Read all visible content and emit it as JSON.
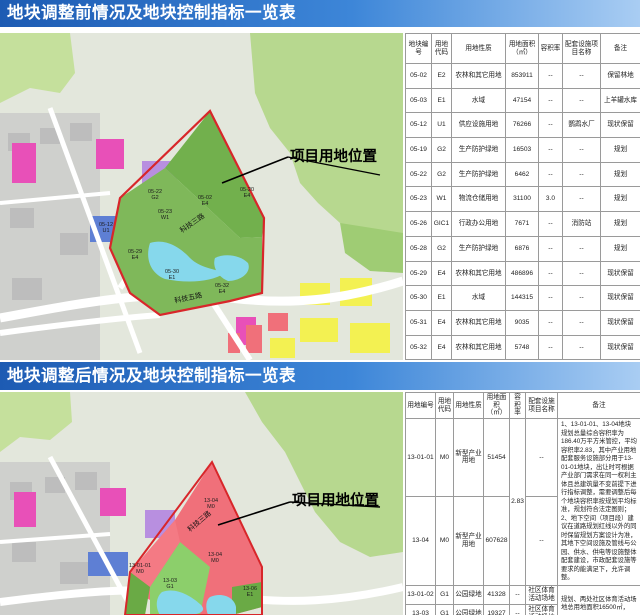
{
  "top_section": {
    "title": "地块调整前情况及地块控制指标一览表",
    "callout": "项目用地位置",
    "map_labels": {
      "road_1": "科技三路",
      "road_2": "科技五路",
      "road_3": "白沙洲大道",
      "road_4": "科技二路",
      "road_5": "四环线大道",
      "parcels": [
        "05-22\nG2",
        "05-23\nW1",
        "05-28\nG2",
        "05-29\nE4",
        "05-30\nE1",
        "05-32\nE4",
        "05-12\nU1",
        "05-02\nE4",
        "05-20\nE4"
      ]
    },
    "table": {
      "headers": [
        "地块编号",
        "用地代码",
        "用地性质",
        "用地面积（㎡）",
        "容积率",
        "配套设施项目名称",
        "备注"
      ],
      "rows": [
        [
          "05-02",
          "E2",
          "农林和其它用地",
          "853911",
          "--",
          "--",
          "保留林地"
        ],
        [
          "05-03",
          "E1",
          "水域",
          "47154",
          "--",
          "--",
          "上羊罐水库"
        ],
        [
          "05-12",
          "U1",
          "供应设施用地",
          "76266",
          "--",
          "鹦鹉水厂",
          "现状保留"
        ],
        [
          "05-19",
          "G2",
          "生产防护绿地",
          "16503",
          "--",
          "--",
          "规划"
        ],
        [
          "05-22",
          "G2",
          "生产防护绿地",
          "6462",
          "--",
          "--",
          "规划"
        ],
        [
          "05-23",
          "W1",
          "物流仓储用地",
          "31100",
          "3.0",
          "--",
          "规划"
        ],
        [
          "05-26",
          "GIC1",
          "行政办公用地",
          "7671",
          "--",
          "消防站",
          "规划"
        ],
        [
          "05-28",
          "G2",
          "生产防护绿地",
          "6876",
          "--",
          "--",
          "规划"
        ],
        [
          "05-29",
          "E4",
          "农林和其它用地",
          "486896",
          "--",
          "--",
          "现状保留"
        ],
        [
          "05-30",
          "E1",
          "水域",
          "144315",
          "--",
          "--",
          "现状保留"
        ],
        [
          "05-31",
          "E4",
          "农林和其它用地",
          "9035",
          "--",
          "--",
          "现状保留"
        ],
        [
          "05-32",
          "E4",
          "农林和其它用地",
          "5748",
          "--",
          "--",
          "现状保留"
        ]
      ]
    }
  },
  "bottom_section": {
    "title": "地块调整后情况及地块控制指标一览表",
    "callout": "项目用地位置",
    "map_labels": {
      "road_1": "科技三路",
      "road_2": "科技五路",
      "parcel_a": "13-04\nM0",
      "parcel_b": "13-01-01\nM0",
      "parcel_c": "13-06\nE1",
      "parcel_d": "13-03\nG1",
      "parcel_e": "13-01-02\nG1",
      "parcel_f": "13-07\nE4"
    },
    "table": {
      "headers": [
        "用地编号",
        "用地代码",
        "用地性质",
        "用地面积（㎡）",
        "容积率",
        "配套设施项目名称",
        "备注"
      ],
      "rows": [
        [
          "13-01-01",
          "M0",
          "新型产业用地",
          "51454",
          "2.83",
          "--"
        ],
        [
          "13-04",
          "M0",
          "新型产业用地",
          "607628",
          "",
          "--"
        ],
        [
          "13-01-02",
          "G1",
          "公园绿地",
          "41328",
          "--",
          "社区体育活动场地"
        ],
        [
          "13-03",
          "G1",
          "公园绿地",
          "19327",
          "--",
          "社区体育活动场地"
        ]
      ],
      "note": "1、13-01-01、13-04地块规划总量综合容积率为186.40万平方米管控，平均容积率2.83，其中产业用地配套服务设施部分用于13-01-01地块，出让时可根据产业部门需求在同一权利主体且总建筑量不变前提下进行指标调整，需要调整后每个地块容积率按规划平均标准，规划符合法定图则；2、地下空间（项目段）建议在道路规划红线以外的同时保留规划方案设计为准，其地下空间设施及管线与公园、供水、供电等设施整体配套建设，市政配套设施等要求的能满足下，允许调整。",
      "extra_bottom": "规划、两处社区体育活动场地总用地面积16500㎡，"
    }
  },
  "colors": {
    "banner": "#2c6fc6",
    "project_outline": "#d8262a",
    "green_park": "#6aaa45",
    "forest": "#a9d07f",
    "water": "#7fd3ea",
    "industrial_new": "#f0707a",
    "residential": "#f2f04d",
    "commercial": "#ec5fb2",
    "public": "#4d72c9",
    "road": "#ffffff"
  }
}
